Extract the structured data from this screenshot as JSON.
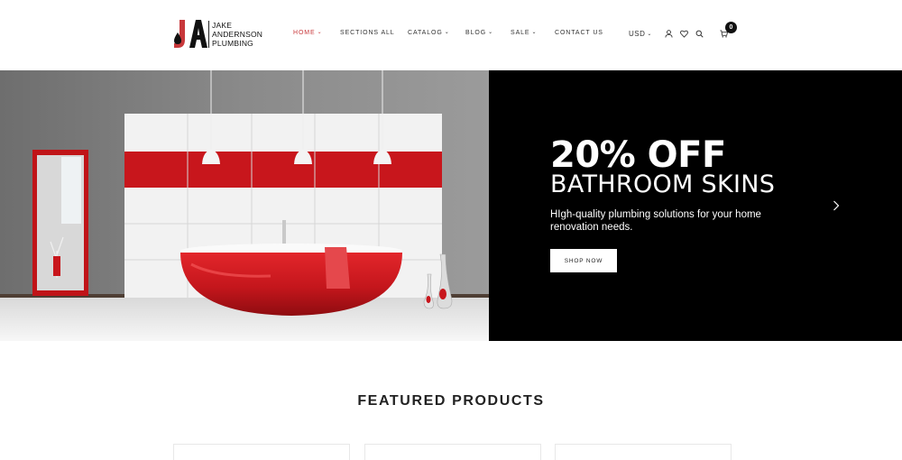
{
  "brand": {
    "logo_initials": "JA",
    "name_lines": [
      "JAKE",
      "ANDERNSON",
      "PLUMBING"
    ],
    "accent_color": "#c8383b"
  },
  "nav": {
    "items": [
      {
        "label": "HOME",
        "dropdown": true,
        "active": true
      },
      {
        "label": "SECTIONS ALL",
        "dropdown": false,
        "active": false
      },
      {
        "label": "CATALOG",
        "dropdown": true,
        "active": false
      },
      {
        "label": "BLOG",
        "dropdown": true,
        "active": false
      },
      {
        "label": "SALE",
        "dropdown": true,
        "active": false
      },
      {
        "label": "CONTACT US",
        "dropdown": false,
        "active": false
      }
    ]
  },
  "header_utils": {
    "currency": "USD",
    "icons": [
      "user-icon",
      "heart-icon",
      "search-icon",
      "cart-icon"
    ],
    "cart_count": "0"
  },
  "hero": {
    "title": "20% OFF",
    "subtitle": "BATHROOM SKINS",
    "description": "HIgh-quality plumbing solutions for your home renovation needs.",
    "cta_label": "SHOP NOW",
    "next_icon": "chevron-right-icon",
    "panel_color": "#000000"
  },
  "featured": {
    "title": "FEATURED PRODUCTS",
    "cards_visible": 3
  }
}
